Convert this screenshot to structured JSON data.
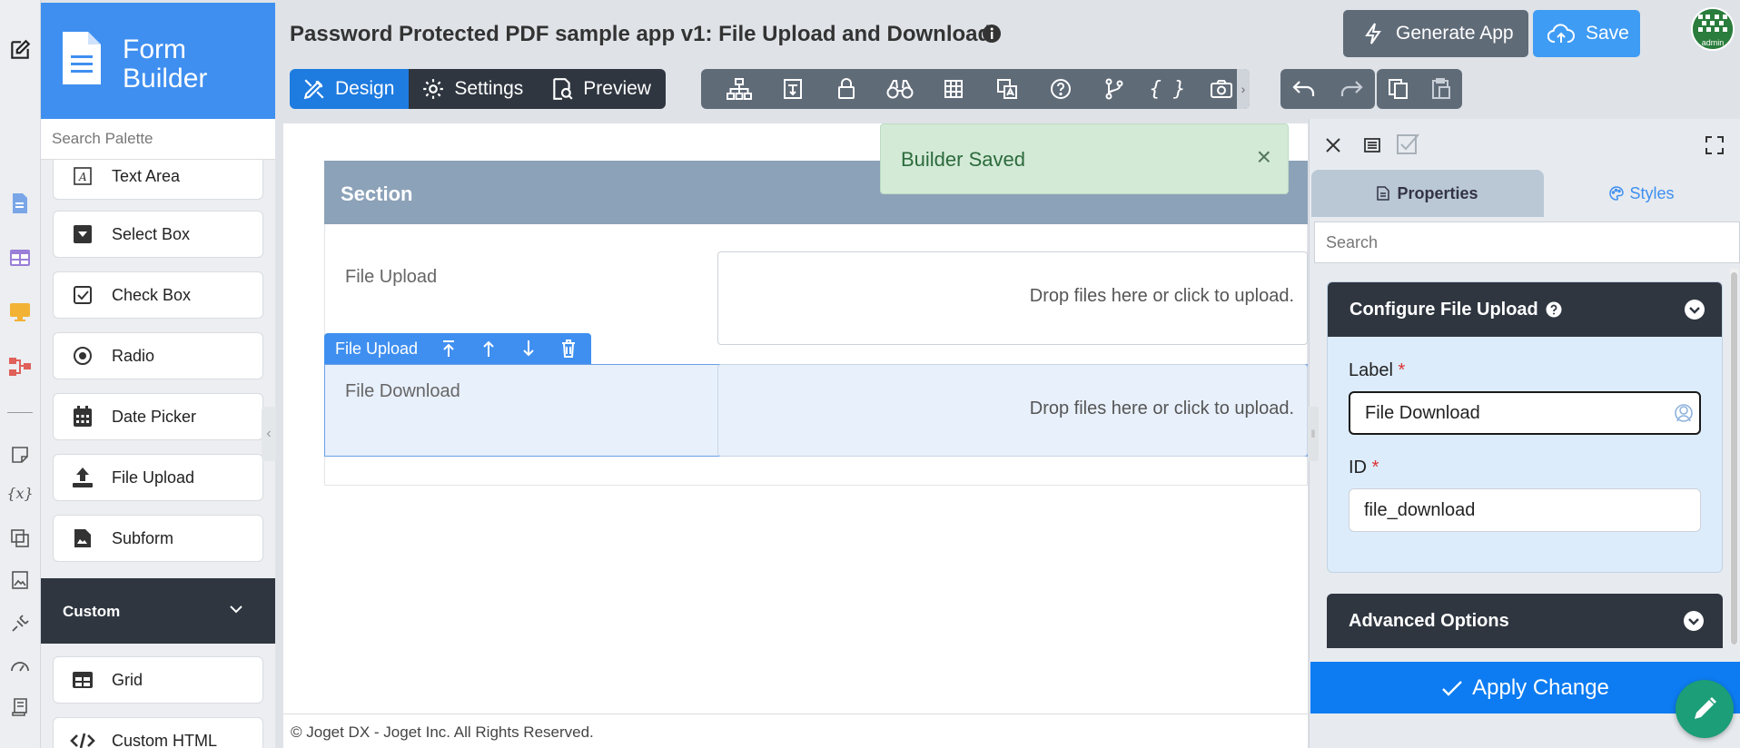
{
  "brand": {
    "line1": "Form",
    "line2": "Builder"
  },
  "palette": {
    "search_placeholder": "Search Palette",
    "items": [
      {
        "label": "Text Area",
        "icon": "text-area-icon"
      },
      {
        "label": "Select Box",
        "icon": "select-box-icon"
      },
      {
        "label": "Check Box",
        "icon": "check-box-icon"
      },
      {
        "label": "Radio",
        "icon": "radio-icon"
      },
      {
        "label": "Date Picker",
        "icon": "calendar-icon"
      },
      {
        "label": "File Upload",
        "icon": "upload-icon"
      },
      {
        "label": "Subform",
        "icon": "subform-icon"
      }
    ],
    "custom_label": "Custom",
    "custom_items": [
      {
        "label": "Grid",
        "icon": "grid-icon"
      },
      {
        "label": "Custom HTML",
        "icon": "code-icon"
      }
    ]
  },
  "header": {
    "title": "Password Protected PDF sample app v1: File Upload and Download",
    "tabs": [
      "Design",
      "Settings",
      "Preview"
    ],
    "generate_label": "Generate App",
    "save_label": "Save",
    "avatar_label": "admin"
  },
  "toast": {
    "message": "Builder Saved",
    "close": "×"
  },
  "form": {
    "section_title": "Section",
    "fields": [
      {
        "label": "File Upload",
        "dropzone": "Drop files here or click to upload."
      },
      {
        "label": "File Download",
        "dropzone": "Drop files here or click to upload."
      }
    ],
    "element_toolbar_label": "File Upload"
  },
  "footer": {
    "text": "© Joget DX - Joget Inc. All Rights Reserved."
  },
  "properties": {
    "tab_properties": "Properties",
    "tab_styles": "Styles",
    "search_placeholder": "Search",
    "config_title": "Configure File Upload",
    "label_field": {
      "label": "Label",
      "value": "File Download"
    },
    "id_field": {
      "label": "ID",
      "value": "file_download"
    },
    "advanced_title": "Advanced Options",
    "apply_label": "Apply Change",
    "required_mark": "*"
  },
  "colors": {
    "primary": "#3f8ff0",
    "dark": "#2f3640",
    "toast_bg": "#d3ead7",
    "apply": "#0d7cf2",
    "fab": "#1c9e78"
  }
}
